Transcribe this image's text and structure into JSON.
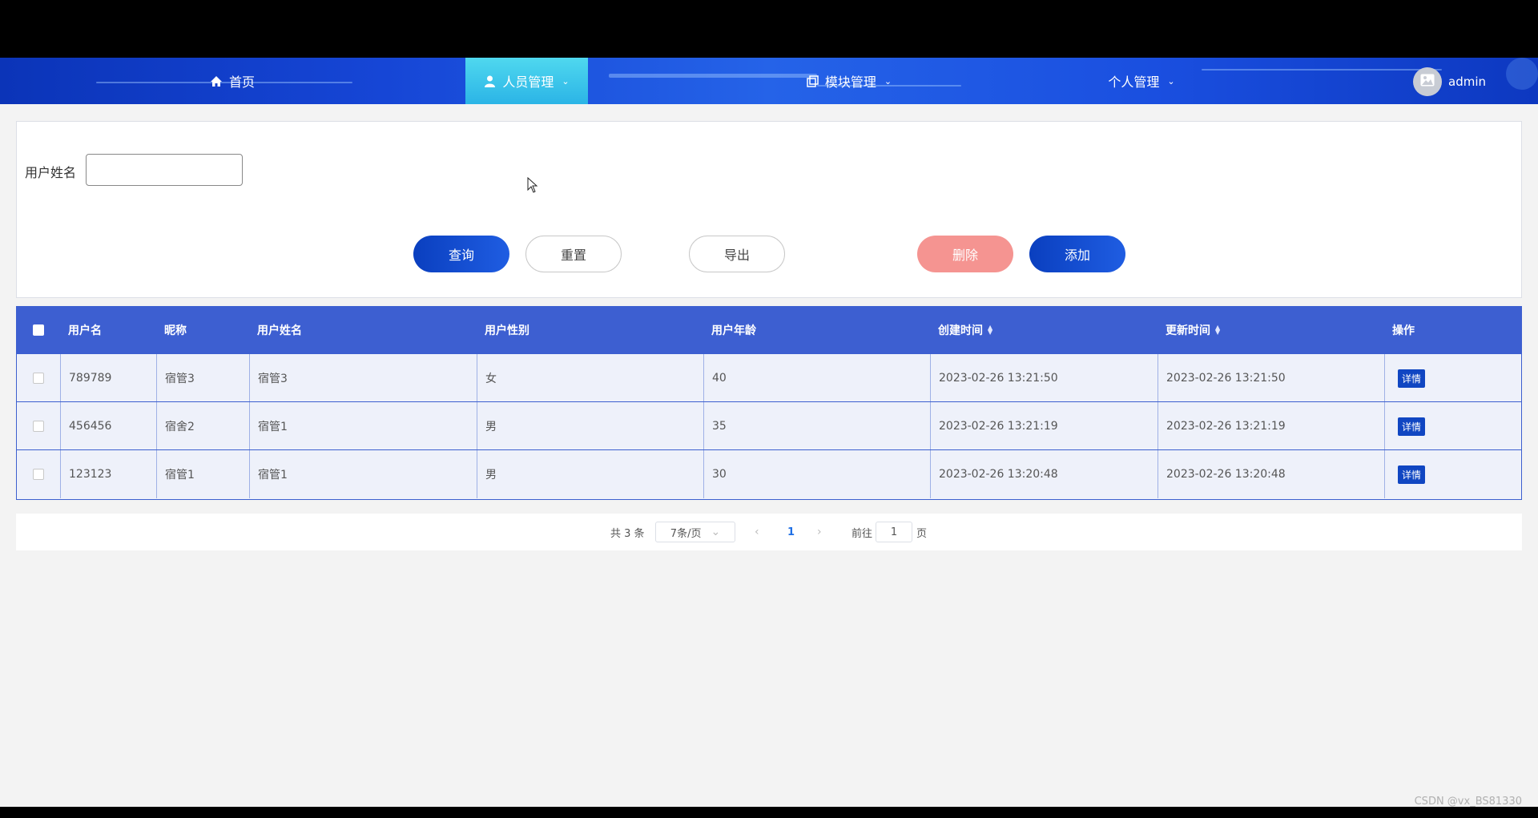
{
  "nav": {
    "items": [
      {
        "label": "首页",
        "icon": "home-icon"
      },
      {
        "label": "人员管理",
        "icon": "user-icon",
        "active": true
      },
      {
        "label": "模块管理",
        "icon": "copy-icon"
      },
      {
        "label": "个人管理"
      }
    ],
    "user": {
      "name": "admin",
      "icon": "image-icon"
    }
  },
  "search": {
    "label": "用户姓名",
    "value": "",
    "buttons": {
      "query": "查询",
      "reset": "重置",
      "export": "导出",
      "delete": "删除",
      "add": "添加"
    }
  },
  "table": {
    "columns": [
      "用户名",
      "昵称",
      "用户姓名",
      "用户性别",
      "用户年龄",
      "创建时间",
      "更新时间",
      "操作"
    ],
    "sortable_columns": [
      "创建时间",
      "更新时间"
    ],
    "rows": [
      {
        "username": "789789",
        "nickname": "宿管3",
        "realname": "宿管3",
        "gender": "女",
        "age": "40",
        "created": "2023-02-26 13:21:50",
        "updated": "2023-02-26 13:21:50",
        "action": "详情"
      },
      {
        "username": "456456",
        "nickname": "宿舍2",
        "realname": "宿管1",
        "gender": "男",
        "age": "35",
        "created": "2023-02-26 13:21:19",
        "updated": "2023-02-26 13:21:19",
        "action": "详情"
      },
      {
        "username": "123123",
        "nickname": "宿管1",
        "realname": "宿管1",
        "gender": "男",
        "age": "30",
        "created": "2023-02-26 13:20:48",
        "updated": "2023-02-26 13:20:48",
        "action": "详情"
      }
    ]
  },
  "pagination": {
    "total": "共 3 条",
    "page_size": "7条/页",
    "current_page": "1",
    "goto_prefix": "前往",
    "goto_value": "1",
    "goto_suffix": "页"
  },
  "watermark": "CSDN @vx_BS81330",
  "colors": {
    "nav_bg": "#1646d6",
    "nav_active": "#2bb4e6",
    "primary": "#1046c2",
    "danger": "#f59491",
    "table_header": "#3d5fd1"
  }
}
